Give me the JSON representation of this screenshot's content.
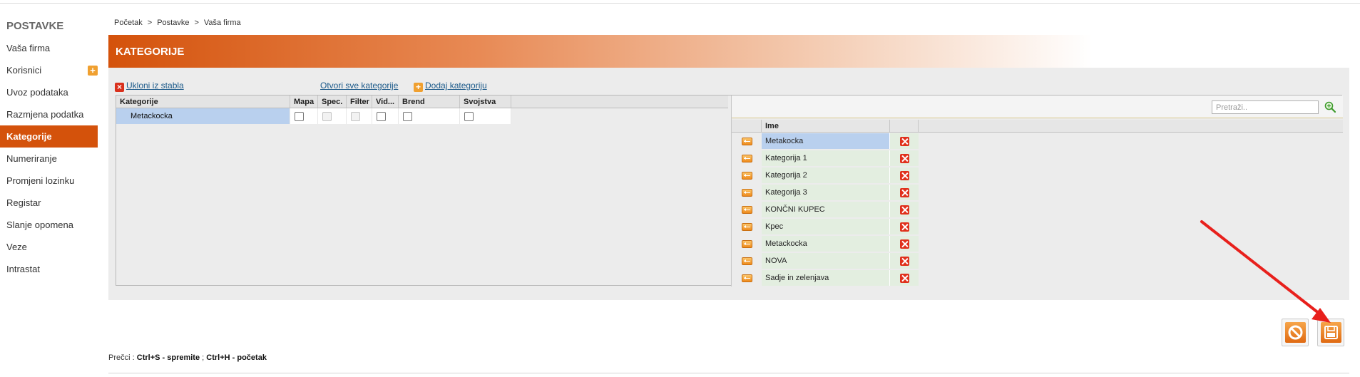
{
  "sidebar": {
    "title": "POSTAVKE",
    "items": [
      {
        "label": "Vaša firma"
      },
      {
        "label": "Korisnici"
      },
      {
        "label": "Uvoz podataka"
      },
      {
        "label": "Razmjena podatka"
      },
      {
        "label": "Kategorije"
      },
      {
        "label": "Numeriranje"
      },
      {
        "label": "Promjeni lozinku"
      },
      {
        "label": "Registar"
      },
      {
        "label": "Slanje opomena"
      },
      {
        "label": "Veze"
      },
      {
        "label": "Intrastat"
      }
    ]
  },
  "breadcrumb": {
    "items": [
      "Početak",
      "Postavke",
      "Vaša firma"
    ],
    "separator": ">"
  },
  "header": {
    "title": "KATEGORIJE"
  },
  "links": {
    "remove_from_tree": "Ukloni iz stabla",
    "open_all": "Otvori sve kategorije",
    "add_category": "Dodaj kategoriju"
  },
  "tree": {
    "columns": [
      "Kategorije",
      "Mapa",
      "Spec.",
      "Filter",
      "Vid...",
      "Brend",
      "Svojstva"
    ],
    "rows": [
      {
        "name": "Metackocka"
      }
    ]
  },
  "right": {
    "search_placeholder": "Pretraži..",
    "column": "Ime",
    "rows": [
      "Metakocka",
      "Kategorija 1",
      "Kategorija 2",
      "Kategorija 3",
      "KONČNI KUPEC",
      "Kpec",
      "Metackocka",
      "NOVA",
      "Sadje in zelenjava"
    ]
  },
  "shortcuts": {
    "label": "Prečci :",
    "save": "Ctrl+S - spremite",
    "sep": ";",
    "home": "Ctrl+H - početak"
  },
  "colors": {
    "accent": "#d4520b",
    "selected_row": "#b9d0ee",
    "row_bg": "#e3eee0",
    "annotation_arrow": "#e8201c"
  }
}
